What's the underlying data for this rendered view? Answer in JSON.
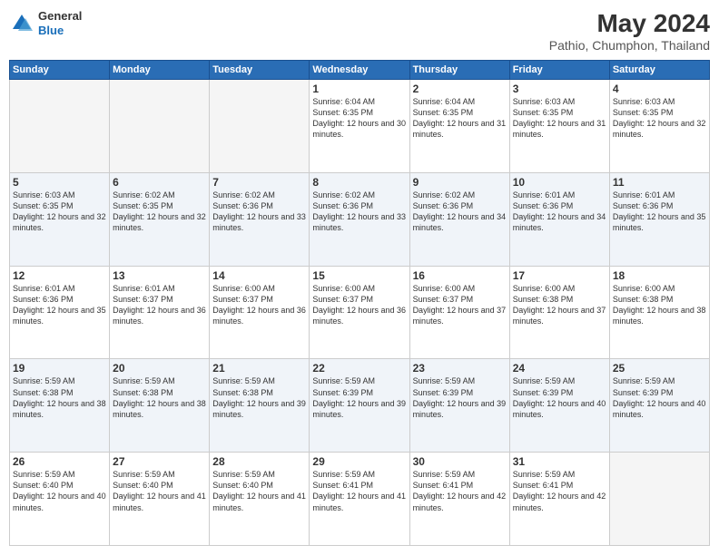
{
  "header": {
    "logo": {
      "general": "General",
      "blue": "Blue"
    },
    "title": "May 2024",
    "location": "Pathio, Chumphon, Thailand"
  },
  "weekdays": [
    "Sunday",
    "Monday",
    "Tuesday",
    "Wednesday",
    "Thursday",
    "Friday",
    "Saturday"
  ],
  "weeks": [
    [
      {
        "day": "",
        "empty": true
      },
      {
        "day": "",
        "empty": true
      },
      {
        "day": "",
        "empty": true
      },
      {
        "day": "1",
        "sunrise": "6:04 AM",
        "sunset": "6:35 PM",
        "daylight": "12 hours and 30 minutes."
      },
      {
        "day": "2",
        "sunrise": "6:04 AM",
        "sunset": "6:35 PM",
        "daylight": "12 hours and 31 minutes."
      },
      {
        "day": "3",
        "sunrise": "6:03 AM",
        "sunset": "6:35 PM",
        "daylight": "12 hours and 31 minutes."
      },
      {
        "day": "4",
        "sunrise": "6:03 AM",
        "sunset": "6:35 PM",
        "daylight": "12 hours and 32 minutes."
      }
    ],
    [
      {
        "day": "5",
        "sunrise": "6:03 AM",
        "sunset": "6:35 PM",
        "daylight": "12 hours and 32 minutes."
      },
      {
        "day": "6",
        "sunrise": "6:02 AM",
        "sunset": "6:35 PM",
        "daylight": "12 hours and 32 minutes."
      },
      {
        "day": "7",
        "sunrise": "6:02 AM",
        "sunset": "6:36 PM",
        "daylight": "12 hours and 33 minutes."
      },
      {
        "day": "8",
        "sunrise": "6:02 AM",
        "sunset": "6:36 PM",
        "daylight": "12 hours and 33 minutes."
      },
      {
        "day": "9",
        "sunrise": "6:02 AM",
        "sunset": "6:36 PM",
        "daylight": "12 hours and 34 minutes."
      },
      {
        "day": "10",
        "sunrise": "6:01 AM",
        "sunset": "6:36 PM",
        "daylight": "12 hours and 34 minutes."
      },
      {
        "day": "11",
        "sunrise": "6:01 AM",
        "sunset": "6:36 PM",
        "daylight": "12 hours and 35 minutes."
      }
    ],
    [
      {
        "day": "12",
        "sunrise": "6:01 AM",
        "sunset": "6:36 PM",
        "daylight": "12 hours and 35 minutes."
      },
      {
        "day": "13",
        "sunrise": "6:01 AM",
        "sunset": "6:37 PM",
        "daylight": "12 hours and 36 minutes."
      },
      {
        "day": "14",
        "sunrise": "6:00 AM",
        "sunset": "6:37 PM",
        "daylight": "12 hours and 36 minutes."
      },
      {
        "day": "15",
        "sunrise": "6:00 AM",
        "sunset": "6:37 PM",
        "daylight": "12 hours and 36 minutes."
      },
      {
        "day": "16",
        "sunrise": "6:00 AM",
        "sunset": "6:37 PM",
        "daylight": "12 hours and 37 minutes."
      },
      {
        "day": "17",
        "sunrise": "6:00 AM",
        "sunset": "6:38 PM",
        "daylight": "12 hours and 37 minutes."
      },
      {
        "day": "18",
        "sunrise": "6:00 AM",
        "sunset": "6:38 PM",
        "daylight": "12 hours and 38 minutes."
      }
    ],
    [
      {
        "day": "19",
        "sunrise": "5:59 AM",
        "sunset": "6:38 PM",
        "daylight": "12 hours and 38 minutes."
      },
      {
        "day": "20",
        "sunrise": "5:59 AM",
        "sunset": "6:38 PM",
        "daylight": "12 hours and 38 minutes."
      },
      {
        "day": "21",
        "sunrise": "5:59 AM",
        "sunset": "6:38 PM",
        "daylight": "12 hours and 39 minutes."
      },
      {
        "day": "22",
        "sunrise": "5:59 AM",
        "sunset": "6:39 PM",
        "daylight": "12 hours and 39 minutes."
      },
      {
        "day": "23",
        "sunrise": "5:59 AM",
        "sunset": "6:39 PM",
        "daylight": "12 hours and 39 minutes."
      },
      {
        "day": "24",
        "sunrise": "5:59 AM",
        "sunset": "6:39 PM",
        "daylight": "12 hours and 40 minutes."
      },
      {
        "day": "25",
        "sunrise": "5:59 AM",
        "sunset": "6:39 PM",
        "daylight": "12 hours and 40 minutes."
      }
    ],
    [
      {
        "day": "26",
        "sunrise": "5:59 AM",
        "sunset": "6:40 PM",
        "daylight": "12 hours and 40 minutes."
      },
      {
        "day": "27",
        "sunrise": "5:59 AM",
        "sunset": "6:40 PM",
        "daylight": "12 hours and 41 minutes."
      },
      {
        "day": "28",
        "sunrise": "5:59 AM",
        "sunset": "6:40 PM",
        "daylight": "12 hours and 41 minutes."
      },
      {
        "day": "29",
        "sunrise": "5:59 AM",
        "sunset": "6:41 PM",
        "daylight": "12 hours and 41 minutes."
      },
      {
        "day": "30",
        "sunrise": "5:59 AM",
        "sunset": "6:41 PM",
        "daylight": "12 hours and 42 minutes."
      },
      {
        "day": "31",
        "sunrise": "5:59 AM",
        "sunset": "6:41 PM",
        "daylight": "12 hours and 42 minutes."
      },
      {
        "day": "",
        "empty": true
      }
    ]
  ]
}
